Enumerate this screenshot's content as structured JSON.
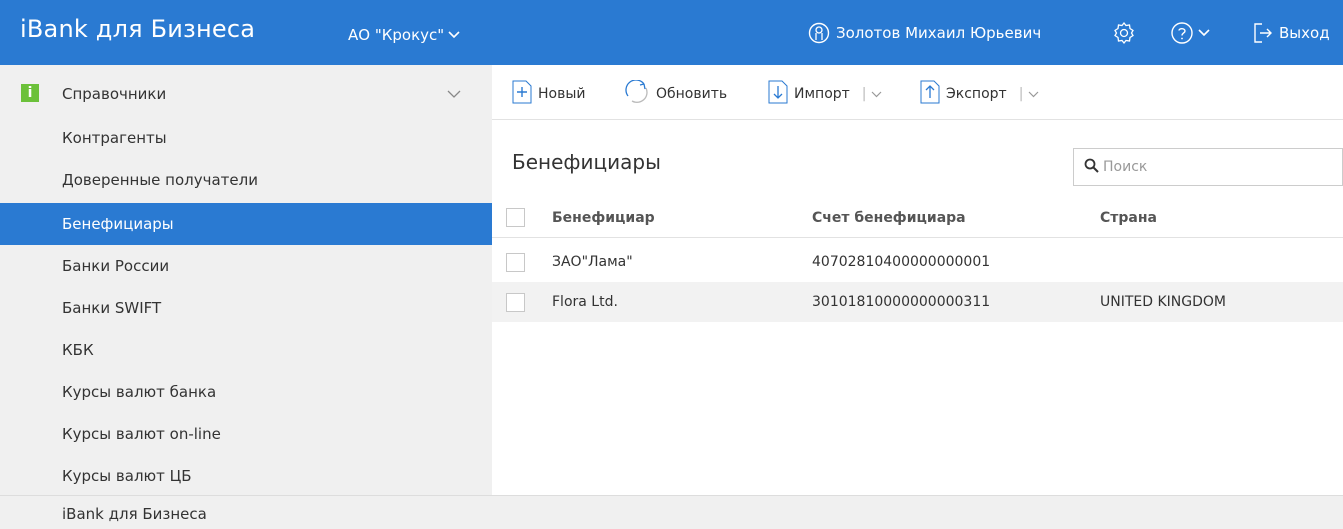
{
  "header": {
    "app_title": "iBank для Бизнеса",
    "organization": "АО \"Крокус\"",
    "user_name": "Золотов Михаил Юрьевич",
    "logout_label": "Выход",
    "accent_color": "#2a7ad2"
  },
  "sidebar": {
    "section_label": "Справочники",
    "section_badge": "i",
    "items": [
      {
        "label": "Контрагенты",
        "active": false
      },
      {
        "label": "Доверенные получатели",
        "active": false
      },
      {
        "label": "Бенефициары",
        "active": true
      },
      {
        "label": "Банки России",
        "active": false
      },
      {
        "label": "Банки SWIFT",
        "active": false
      },
      {
        "label": "КБК",
        "active": false
      },
      {
        "label": "Курсы валют банка",
        "active": false
      },
      {
        "label": "Курсы валют on-line",
        "active": false
      },
      {
        "label": "Курсы валют ЦБ",
        "active": false
      }
    ]
  },
  "footer": {
    "label": "iBank для Бизнеса"
  },
  "toolbar": {
    "new_label": "Новый",
    "refresh_label": "Обновить",
    "import_label": "Импорт",
    "export_label": "Экспорт"
  },
  "main": {
    "page_title": "Бенефициары",
    "search_placeholder": "Поиск"
  },
  "table": {
    "columns": [
      "Бенефициар",
      "Счет бенефициара",
      "Страна"
    ],
    "rows": [
      {
        "beneficiary": "ЗАО\"Лама\"",
        "account": "40702810400000000001",
        "country": ""
      },
      {
        "beneficiary": "Flora Ltd.",
        "account": "30101810000000000311",
        "country": "UNITED KINGDOM"
      }
    ]
  }
}
